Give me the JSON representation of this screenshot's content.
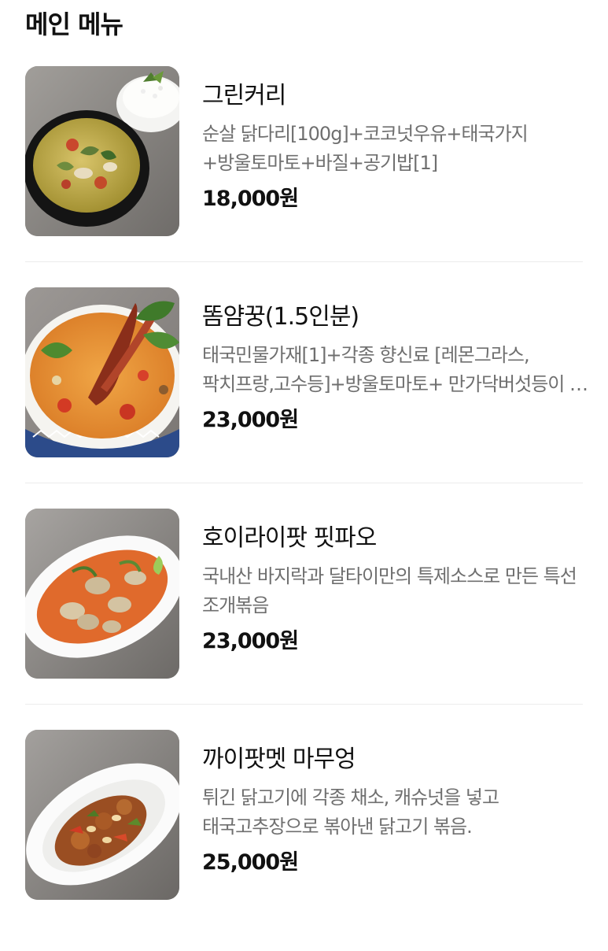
{
  "section": {
    "title": "메인 메뉴"
  },
  "menu": {
    "items": [
      {
        "name": "그린커리",
        "description": "순살 닭다리[100g]+코코넛우유+태국가지+방울토마토+바질+공기밥[1]",
        "price": "18,000원",
        "image_icon": "green-curry-photo"
      },
      {
        "name": "똠얌꿍(1.5인분)",
        "description": "태국민물가재[1]+각종 향신료 [레몬그라스,팍치프랑,고수등]+방울토마토+ 만가닥버섯등이 …",
        "price": "23,000원",
        "image_icon": "tom-yum-photo"
      },
      {
        "name": "호이라이팟 핏파오",
        "description": "국내산 바지락과 달타이만의 특제소스로 만든 특선 조개볶음",
        "price": "23,000원",
        "image_icon": "clam-stirfry-photo"
      },
      {
        "name": "까이팟멧 마무엉",
        "description": "튀긴 닭고기에 각종 채소, 캐슈넛을 넣고 태국고추장으로 볶아낸 닭고기 볶음.",
        "price": "25,000원",
        "image_icon": "cashew-chicken-photo"
      }
    ]
  }
}
